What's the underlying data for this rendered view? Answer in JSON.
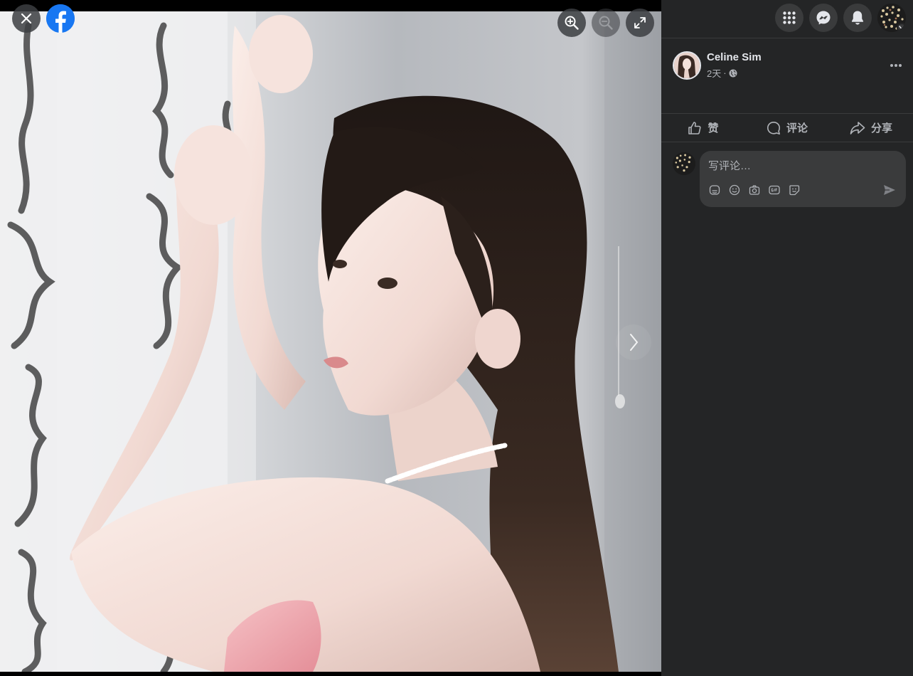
{
  "viewer": {
    "close_icon": "close-icon",
    "logo_icon": "facebook-logo-icon",
    "zoom_in_icon": "zoom-in-icon",
    "zoom_out_icon": "zoom-out-icon",
    "fullscreen_icon": "fullscreen-icon",
    "next_icon": "chevron-right-icon"
  },
  "topbar": {
    "icons": [
      "menu-grid-icon",
      "messenger-icon",
      "bell-icon",
      "account-avatar"
    ]
  },
  "post": {
    "author": "Celine Sim",
    "time": "2天",
    "separator": "·",
    "privacy_icon": "globe-icon",
    "more_icon": "more-dots-icon"
  },
  "actions": {
    "like": "赞",
    "comment": "评论",
    "share": "分享"
  },
  "comment": {
    "placeholder": "写评论…",
    "tools": [
      "sticker-icon",
      "emoji-icon",
      "camera-icon",
      "gif-icon",
      "avatar-sticker-icon"
    ],
    "send_icon": "send-icon"
  },
  "colors": {
    "panel_bg": "#242526",
    "input_bg": "#3a3b3c",
    "accent": "#1877f2",
    "text_primary": "#e4e6eb",
    "text_secondary": "#b0b3b8"
  }
}
